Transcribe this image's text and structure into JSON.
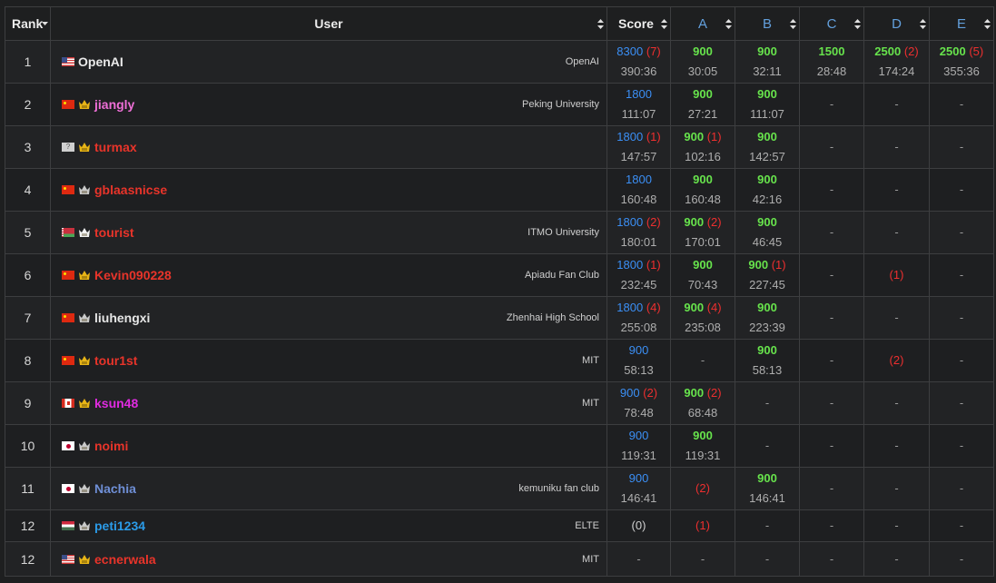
{
  "header": {
    "rank": "Rank",
    "user": "User",
    "score": "Score",
    "problems": [
      "A",
      "B",
      "C",
      "D",
      "E"
    ]
  },
  "colors": {
    "background": "#1e1f20",
    "score_blue": "#3b8ff5",
    "solved_green": "#67e34c",
    "penalty_red": "#ee2f2f",
    "problem_header_blue": "#63a0dd"
  },
  "rows": [
    {
      "rank": "1",
      "flag": "us-flag-icon",
      "badge": "",
      "name": "OpenAI",
      "name_color": "#eaeaea",
      "org": "OpenAI",
      "score": "8300",
      "score_pen": "(7)",
      "score_time": "390:36",
      "cells": [
        {
          "pts": "900",
          "pen": "",
          "time": "30:05"
        },
        {
          "pts": "900",
          "pen": "",
          "time": "32:11"
        },
        {
          "pts": "1500",
          "pen": "",
          "time": "28:48"
        },
        {
          "pts": "2500",
          "pen": "(2)",
          "time": "174:24"
        },
        {
          "pts": "2500",
          "pen": "(5)",
          "time": "355:36"
        }
      ]
    },
    {
      "rank": "2",
      "flag": "cn-flag-icon",
      "badge": "gold",
      "name": "jiangly",
      "name_color": "#ee6fd7",
      "org": "Peking University",
      "score": "1800",
      "score_pen": "",
      "score_time": "111:07",
      "cells": [
        {
          "pts": "900",
          "pen": "",
          "time": "27:21"
        },
        {
          "pts": "900",
          "pen": "",
          "time": "111:07"
        },
        {
          "dash": "-"
        },
        {
          "dash": "-"
        },
        {
          "dash": "-"
        }
      ]
    },
    {
      "rank": "3",
      "flag": "unknown-flag-icon",
      "badge": "gold",
      "name": "turmax",
      "name_color": "#e8342a",
      "org": "",
      "score": "1800",
      "score_pen": "(1)",
      "score_time": "147:57",
      "cells": [
        {
          "pts": "900",
          "pen": "(1)",
          "time": "102:16"
        },
        {
          "pts": "900",
          "pen": "",
          "time": "142:57"
        },
        {
          "dash": "-"
        },
        {
          "dash": "-"
        },
        {
          "dash": "-"
        }
      ]
    },
    {
      "rank": "4",
      "flag": "cn-flag-icon",
      "badge": "silver",
      "name": "gblaasnicse",
      "name_color": "#e8342a",
      "org": "",
      "score": "1800",
      "score_pen": "",
      "score_time": "160:48",
      "cells": [
        {
          "pts": "900",
          "pen": "",
          "time": "160:48"
        },
        {
          "pts": "900",
          "pen": "",
          "time": "42:16"
        },
        {
          "dash": "-"
        },
        {
          "dash": "-"
        },
        {
          "dash": "-"
        }
      ]
    },
    {
      "rank": "5",
      "flag": "by-flag-icon",
      "badge": "white",
      "name": "tourist",
      "name_color": "#e8342a",
      "org": "ITMO University",
      "score": "1800",
      "score_pen": "(2)",
      "score_time": "180:01",
      "cells": [
        {
          "pts": "900",
          "pen": "(2)",
          "time": "170:01"
        },
        {
          "pts": "900",
          "pen": "",
          "time": "46:45"
        },
        {
          "dash": "-"
        },
        {
          "dash": "-"
        },
        {
          "dash": "-"
        }
      ]
    },
    {
      "rank": "6",
      "flag": "cn-flag-icon",
      "badge": "gold",
      "name": "Kevin090228",
      "name_color": "#e8342a",
      "org": "Apiadu Fan Club",
      "score": "1800",
      "score_pen": "(1)",
      "score_time": "232:45",
      "cells": [
        {
          "pts": "900",
          "pen": "",
          "time": "70:43"
        },
        {
          "pts": "900",
          "pen": "(1)",
          "time": "227:45"
        },
        {
          "dash": "-"
        },
        {
          "fail": "(1)"
        },
        {
          "dash": "-"
        }
      ]
    },
    {
      "rank": "7",
      "flag": "cn-flag-icon",
      "badge": "silver",
      "name": "liuhengxi",
      "name_color": "#e6e6e6",
      "org": "Zhenhai High School",
      "score": "1800",
      "score_pen": "(4)",
      "score_time": "255:08",
      "cells": [
        {
          "pts": "900",
          "pen": "(4)",
          "time": "235:08"
        },
        {
          "pts": "900",
          "pen": "",
          "time": "223:39"
        },
        {
          "dash": "-"
        },
        {
          "dash": "-"
        },
        {
          "dash": "-"
        }
      ]
    },
    {
      "rank": "8",
      "flag": "cn-flag-icon",
      "badge": "gold",
      "name": "tour1st",
      "name_color": "#e8342a",
      "org": "MIT",
      "score": "900",
      "score_pen": "",
      "score_time": "58:13",
      "cells": [
        {
          "dash": "-"
        },
        {
          "pts": "900",
          "pen": "",
          "time": "58:13"
        },
        {
          "dash": "-"
        },
        {
          "fail": "(2)"
        },
        {
          "dash": "-"
        }
      ]
    },
    {
      "rank": "9",
      "flag": "ca-flag-icon",
      "badge": "gold",
      "name": "ksun48",
      "name_color": "#e02be0",
      "org": "MIT",
      "score": "900",
      "score_pen": "(2)",
      "score_time": "78:48",
      "cells": [
        {
          "pts": "900",
          "pen": "(2)",
          "time": "68:48"
        },
        {
          "dash": "-"
        },
        {
          "dash": "-"
        },
        {
          "dash": "-"
        },
        {
          "dash": "-"
        }
      ]
    },
    {
      "rank": "10",
      "flag": "jp-flag-icon",
      "badge": "silver",
      "name": "noimi",
      "name_color": "#e8342a",
      "org": "",
      "score": "900",
      "score_pen": "",
      "score_time": "119:31",
      "cells": [
        {
          "pts": "900",
          "pen": "",
          "time": "119:31"
        },
        {
          "dash": "-"
        },
        {
          "dash": "-"
        },
        {
          "dash": "-"
        },
        {
          "dash": "-"
        }
      ]
    },
    {
      "rank": "11",
      "flag": "jp-flag-icon",
      "badge": "silver",
      "name": "Nachia",
      "name_color": "#6f8fd6",
      "org": "kemuniku fan club",
      "score": "900",
      "score_pen": "",
      "score_time": "146:41",
      "cells": [
        {
          "fail": "(2)"
        },
        {
          "pts": "900",
          "pen": "",
          "time": "146:41"
        },
        {
          "dash": "-"
        },
        {
          "dash": "-"
        },
        {
          "dash": "-"
        }
      ]
    },
    {
      "rank": "12",
      "flag": "hu-flag-icon",
      "badge": "silver",
      "name": "peti1234",
      "name_color": "#2b9be8",
      "org": "ELTE",
      "score_plain": "(0)",
      "cells": [
        {
          "fail": "(1)"
        },
        {
          "dash": "-"
        },
        {
          "dash": "-"
        },
        {
          "dash": "-"
        },
        {
          "dash": "-"
        }
      ]
    },
    {
      "rank": "12",
      "flag": "us-flag-icon",
      "badge": "gold",
      "name": "ecnerwala",
      "name_color": "#e8342a",
      "org": "MIT",
      "score_dash": "-",
      "cells": [
        {
          "dash": "-"
        },
        {
          "dash": "-"
        },
        {
          "dash": "-"
        },
        {
          "dash": "-"
        },
        {
          "dash": "-"
        }
      ]
    }
  ]
}
